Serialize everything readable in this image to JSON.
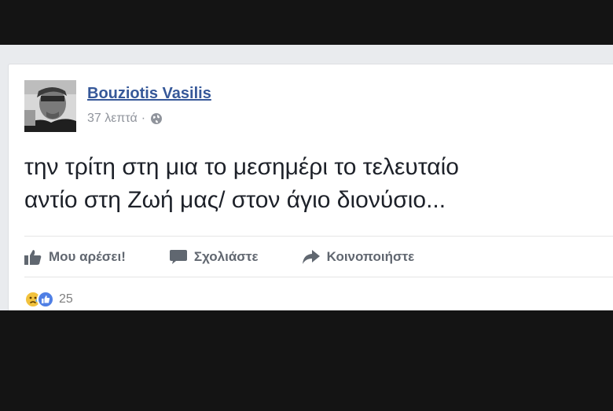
{
  "post": {
    "author": "Bouziotis Vasilis",
    "time": "37 λεπτά",
    "separator": "·",
    "privacy_icon": "globe-icon",
    "text_lines": [
      "την τρίτη στη μια το μεσημέρι το τελευταίο",
      "αντίο στη Ζωή μας/ στον άγιο διονύσιο..."
    ]
  },
  "actions": {
    "like_label": "Μου αρέσει!",
    "like_icon": "thumbs-up-icon",
    "comment_label": "Σχολιάστε",
    "comment_icon": "comment-icon",
    "share_label": "Κοινοποιήστε",
    "share_icon": "share-arrow-icon"
  },
  "reactions": {
    "icons": [
      "sad-reaction-icon",
      "like-reaction-icon"
    ],
    "count": "25"
  },
  "colors": {
    "author_link": "#365899",
    "meta_text": "#90949c",
    "action_text": "#616770",
    "page_background": "#e9ebee"
  }
}
